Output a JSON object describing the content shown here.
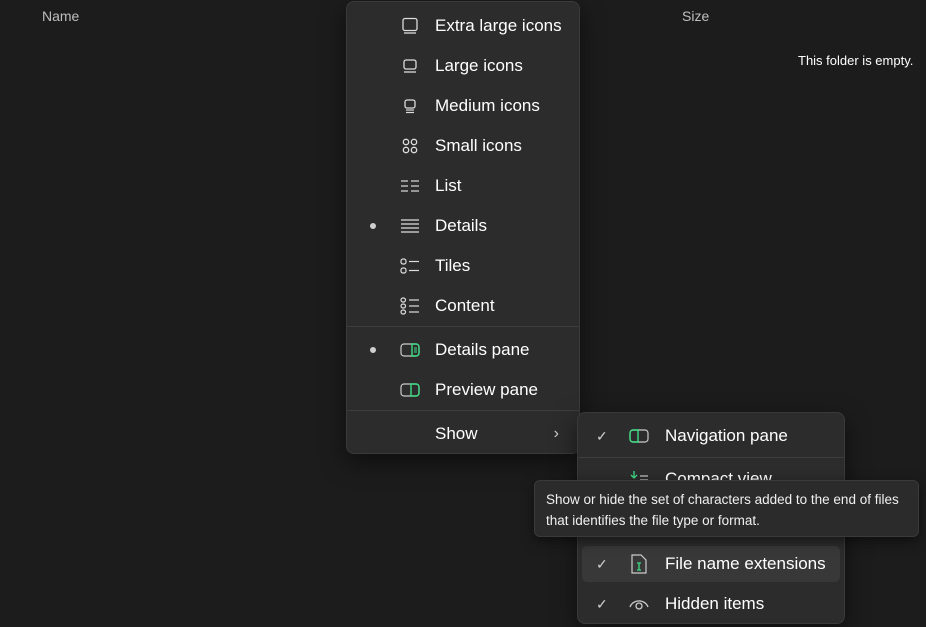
{
  "columns": {
    "name": "Name",
    "size": "Size"
  },
  "empty_message": "This folder is empty.",
  "view_menu": {
    "items": [
      {
        "label": "Extra large icons",
        "icon": "extra-large-icons-icon",
        "selected": false
      },
      {
        "label": "Large icons",
        "icon": "large-icons-icon",
        "selected": false
      },
      {
        "label": "Medium icons",
        "icon": "medium-icons-icon",
        "selected": false
      },
      {
        "label": "Small icons",
        "icon": "small-icons-icon",
        "selected": false
      },
      {
        "label": "List",
        "icon": "list-icon",
        "selected": false
      },
      {
        "label": "Details",
        "icon": "details-icon",
        "selected": true
      },
      {
        "label": "Tiles",
        "icon": "tiles-icon",
        "selected": false
      },
      {
        "label": "Content",
        "icon": "content-icon",
        "selected": false
      }
    ],
    "panes": [
      {
        "label": "Details pane",
        "icon": "details-pane-icon",
        "selected": true
      },
      {
        "label": "Preview pane",
        "icon": "preview-pane-icon",
        "selected": false
      }
    ],
    "show": "Show"
  },
  "show_menu": {
    "items": [
      {
        "label": "Navigation pane",
        "checked": true
      },
      {
        "label": "Compact view",
        "checked": false
      },
      {
        "label": "File name extensions",
        "checked": true
      },
      {
        "label": "Hidden items",
        "checked": true
      }
    ]
  },
  "tooltip": "Show or hide the set of characters added to the end of files that identifies the file type or format.",
  "colors": {
    "accent": "#3ddc84",
    "background": "#1c1c1c",
    "menu": "#2c2c2c"
  }
}
